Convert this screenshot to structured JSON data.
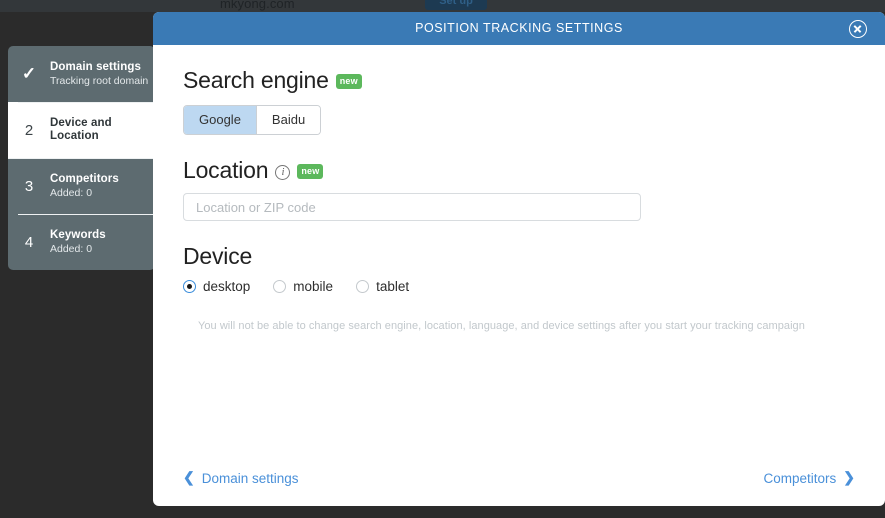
{
  "background": {
    "domain_text": "mkyong.com",
    "setup_button_label": "Set up"
  },
  "sidebar": {
    "steps": [
      {
        "marker": "✓",
        "title": "Domain settings",
        "subtitle": "Tracking root domain",
        "active": false
      },
      {
        "marker": "2",
        "title": "Device and Location",
        "subtitle": "",
        "active": true
      },
      {
        "marker": "3",
        "title": "Competitors",
        "subtitle": "Added: 0",
        "active": false
      },
      {
        "marker": "4",
        "title": "Keywords",
        "subtitle": "Added: 0",
        "active": false
      }
    ]
  },
  "modal": {
    "title": "POSITION TRACKING SETTINGS",
    "close_icon": "close-icon",
    "search_engine": {
      "heading": "Search engine",
      "badge": "new",
      "options": [
        {
          "label": "Google",
          "selected": true
        },
        {
          "label": "Baidu",
          "selected": false
        }
      ]
    },
    "location": {
      "heading": "Location",
      "info_icon": "info-circle-icon",
      "badge": "new",
      "placeholder": "Location or ZIP code",
      "value": ""
    },
    "device": {
      "heading": "Device",
      "options": [
        {
          "label": "desktop",
          "selected": true
        },
        {
          "label": "mobile",
          "selected": false
        },
        {
          "label": "tablet",
          "selected": false
        }
      ],
      "note": "You will not be able to change search engine, location, language, and device settings after you start your tracking campaign"
    },
    "footer": {
      "prev_label": "Domain settings",
      "prev_icon": "chevron-left-icon",
      "next_label": "Competitors",
      "next_icon": "chevron-right-icon"
    }
  },
  "colors": {
    "header_blue": "#3a7ab5",
    "link_blue": "#4a90d9",
    "badge_green": "#5cb85c",
    "sidebar_slate": "#5d6b70",
    "overlay_dark": "#2b2b2b",
    "selected_toggle": "#bdd8f1"
  }
}
